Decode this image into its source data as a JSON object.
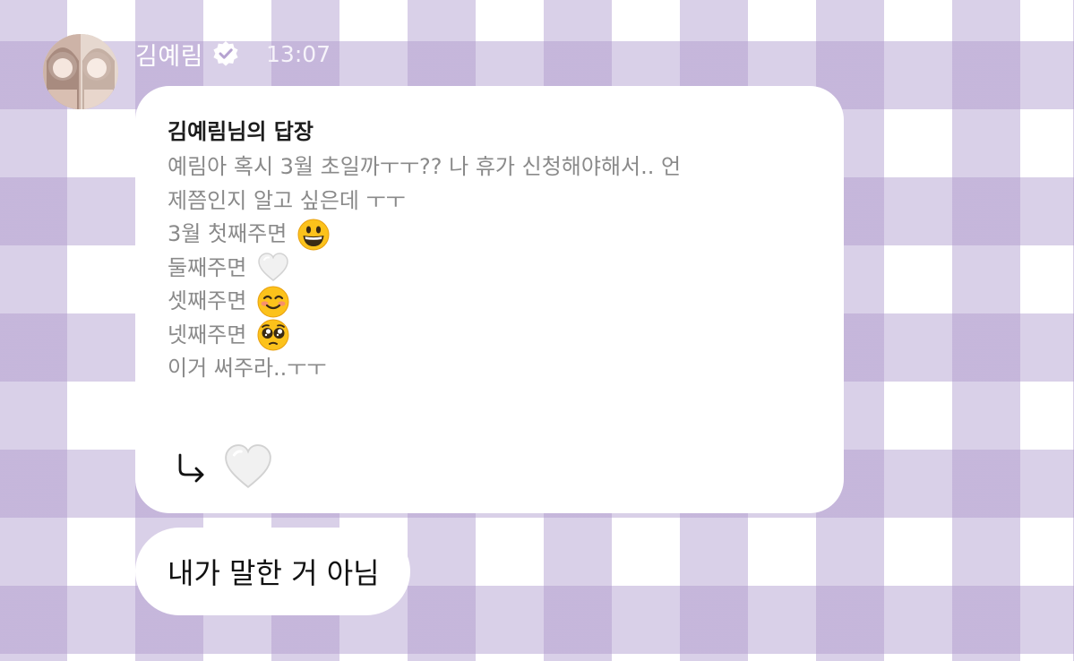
{
  "sender": {
    "name": "김예림",
    "time": "13:07"
  },
  "reply_card": {
    "title": "김예림님의 답장",
    "quote_lines": [
      "예림아 혹시 3월 초일까ㅜㅜ?? 나 휴가 신청해야해서.. 언",
      "제쯤인지 알고 싶은데 ㅜㅜ",
      "3월 첫째주면",
      "둘째주면",
      "셋째주면",
      "넷째주면",
      "이거 써주라..ㅜㅜ"
    ],
    "reply_emoji": "white-heart-icon"
  },
  "message": {
    "text": "내가 말한 거 아님"
  },
  "colors": {
    "check_lavender": "#b09cce",
    "bubble": "#ffffff",
    "quote_text": "#8a8a8a"
  }
}
